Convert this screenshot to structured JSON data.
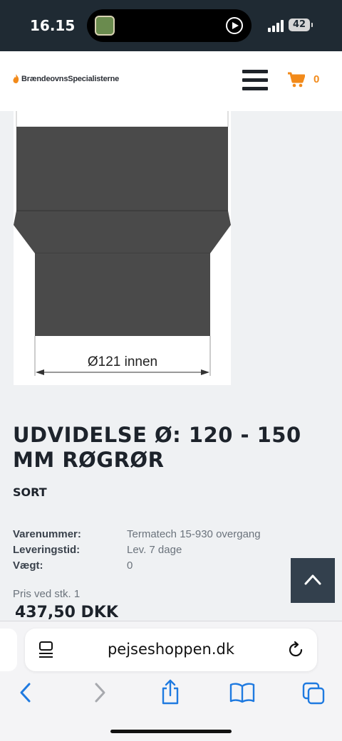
{
  "status_bar": {
    "time": "16.15",
    "battery": "42"
  },
  "header": {
    "logo_text": "BrændeovnsSpecialisterne",
    "cart_count": "0"
  },
  "product_image": {
    "dimension_label": "Ø121 innen"
  },
  "product": {
    "title": "UDVIDELSE Ø: 120 - 150 MM RØGRØR",
    "variant": "SORT",
    "specs": [
      {
        "label": "Varenummer:",
        "value": "Termatech 15-930 overgang"
      },
      {
        "label": "Leveringstid:",
        "value": "Lev. 7 dage"
      },
      {
        "label": "Vægt:",
        "value": "0"
      }
    ],
    "price_label": "Pris ved stk. 1",
    "price": "437,50  DKK"
  },
  "browser": {
    "url": "pejseshoppen.dk"
  },
  "colors": {
    "accent": "#f28a1a",
    "header_dark": "#1f2a33",
    "scroll_button": "#33404d",
    "ios_blue": "#1f7ae0"
  }
}
